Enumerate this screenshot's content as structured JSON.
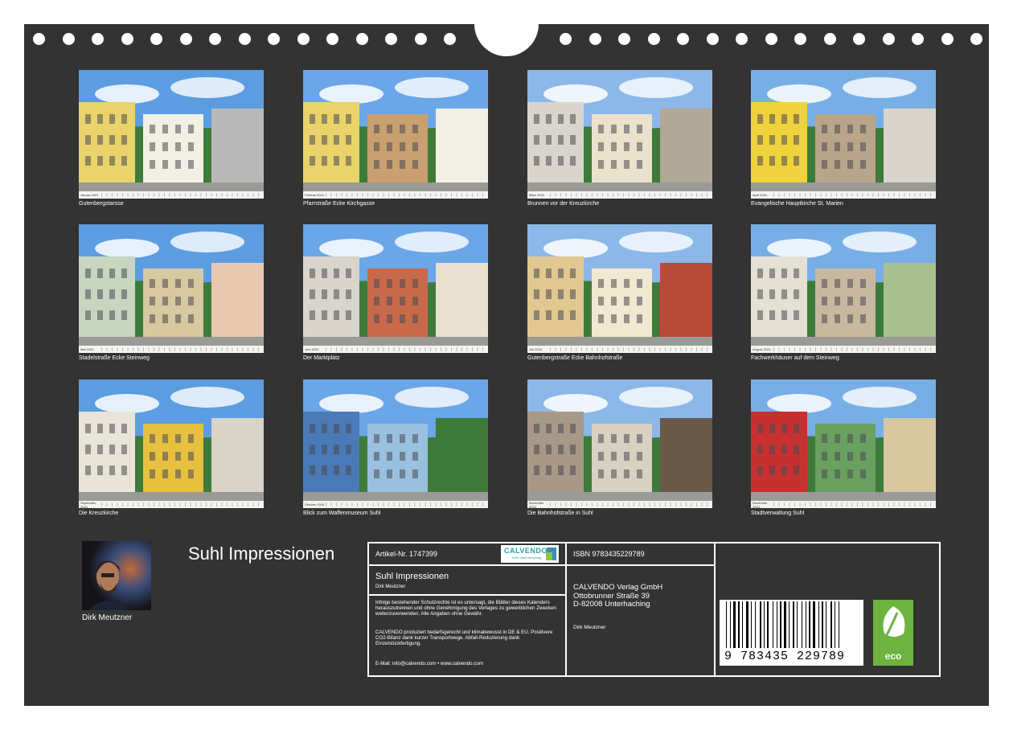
{
  "calendar_title": "Suhl Impressionen",
  "author": "Dirk Meutzner",
  "colors": {
    "background": "#333333",
    "text": "#ffffff",
    "calvendo": "#2a9fa0",
    "eco": "#6db33f"
  },
  "months": [
    {
      "month": "Januar 2024",
      "caption": "Gutenbergstarsse"
    },
    {
      "month": "Februar 2024",
      "caption": "Pfarrstraße Ecke Kirchgasse"
    },
    {
      "month": "März 2024",
      "caption": "Brunnen vor der Kreuzkirche"
    },
    {
      "month": "April 2024",
      "caption": "Evangelische Hauptkirche St. Marien"
    },
    {
      "month": "Mai 2024",
      "caption": "Stadelstraße Ecke Steinweg"
    },
    {
      "month": "Juni 2024",
      "caption": "Der Marktplatz"
    },
    {
      "month": "Juli 2024",
      "caption": "Gutenbergstraße Ecke Bahnhofstraße"
    },
    {
      "month": "August 2024",
      "caption": "Fachwerkhäuser auf dem Steinweg"
    },
    {
      "month": "September 2024",
      "caption": "Die Kreuzkirche"
    },
    {
      "month": "Oktober 2024",
      "caption": "Blick zum Waffenmuseum Suhl"
    },
    {
      "month": "November 2024",
      "caption": "Die Bahnhofstraße in Suhl"
    },
    {
      "month": "Dezember 2024",
      "caption": "Stadtverwaltung Suhl"
    }
  ],
  "info": {
    "article": "Artikel-Nr. 1747399",
    "logo_text": "CALVENDO",
    "logo_sub": "Dein Kalenderverlag",
    "title": "Suhl Impressionen",
    "author": "Dirk Meutzner",
    "copyright": "Infolge bestehender Schutzrechte ist es untersagt, die Blätter dieses Kalenders herauszutrennen und ohne Genehmigung des Verlages zu gewerblichen Zwecken weiterzuverwenden. Alle Angaben ohne Gewähr.",
    "eco_note": "CALVENDO produziert bedarfsgerecht und klimabewusst in DE & EU. Positivere CO2-Bilanz dank kurzer Transportwege. Abfall-Reduzierung dank Einzelstückfertigung.",
    "contact": "E-Mail: info@calvendo.com • www.calvendo.com",
    "isbn": "ISBN 9783435229789",
    "publisher_line1": "CALVENDO Verlag GmbH",
    "publisher_line2": "Ottobrunner Straße 39",
    "publisher_line3": "D-82008 Unterhaching",
    "publisher_author": "Dirk Meutzner",
    "barcode_number": "9 783435 229789",
    "eco_label": "eco"
  }
}
